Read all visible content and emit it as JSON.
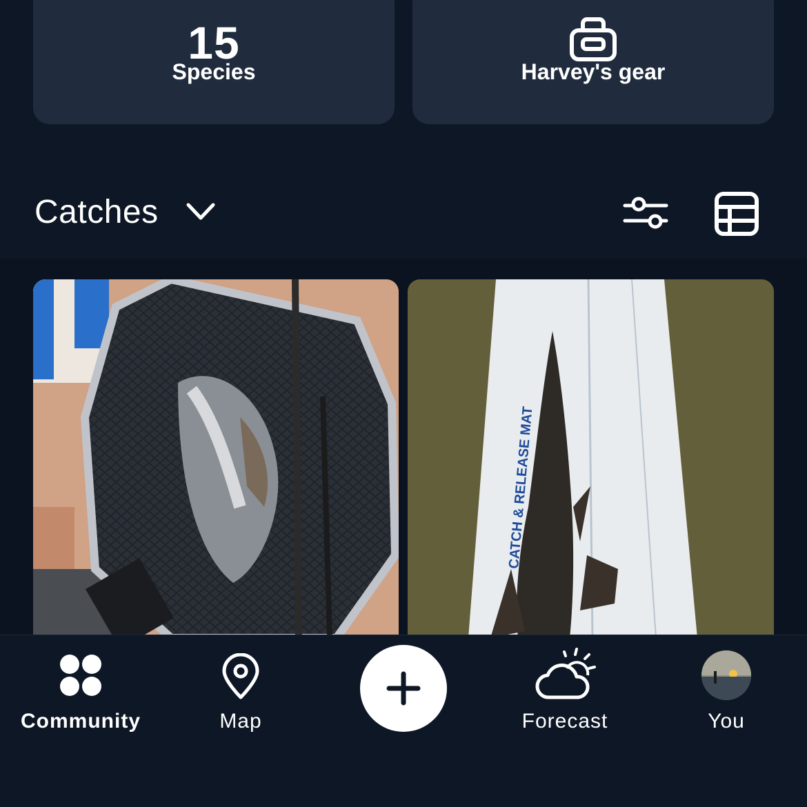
{
  "stats": {
    "species_count": "15",
    "species_label": "Species",
    "gear_label": "Harvey's gear",
    "gear_icon": "tackle-box-icon"
  },
  "catches": {
    "title": "Catches",
    "dropdown_icon": "chevron-down-icon",
    "filter_icon": "sliders-icon",
    "view_icon": "table-icon",
    "photos": [
      {
        "alt": "fish in landing net"
      },
      {
        "alt": "flathead on catch and release mat"
      }
    ],
    "mat_text": "CATCH & RELEASE MAT"
  },
  "nav": {
    "community": "Community",
    "map": "Map",
    "add": "+",
    "forecast": "Forecast",
    "you": "You"
  },
  "colors": {
    "background": "#0e1726",
    "card": "#202c3e",
    "text": "#ffffff"
  }
}
